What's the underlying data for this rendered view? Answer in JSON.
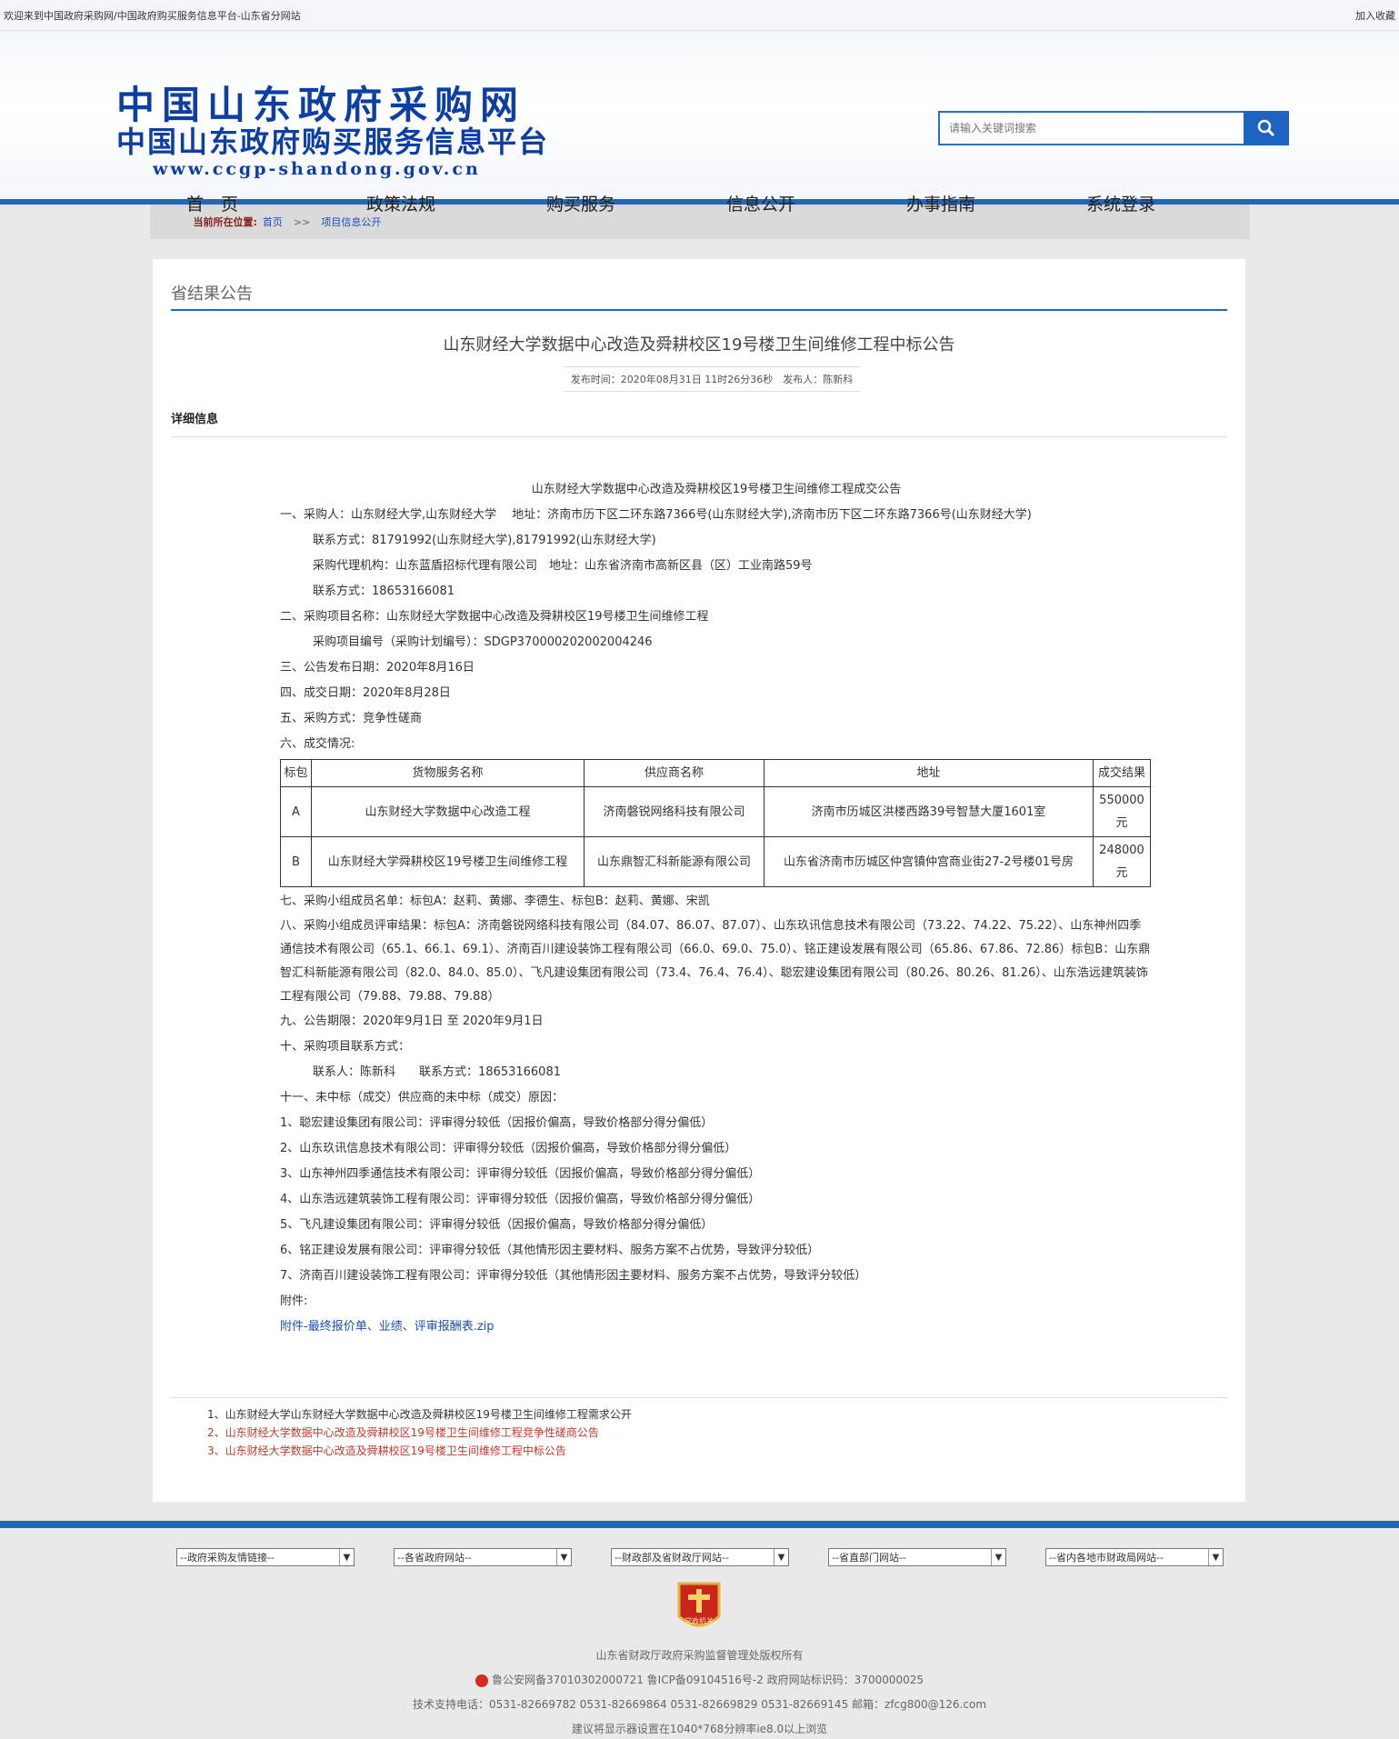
{
  "topbar": {
    "welcome": "欢迎来到中国政府采购网/中国政府购买服务信息平台-山东省分网站",
    "bookmark": "加入收藏"
  },
  "logo": {
    "line1": "中国山东政府采购网",
    "line2": "中国山东政府购买服务信息平台",
    "line3": "www.ccgp-shandong.gov.cn"
  },
  "search": {
    "placeholder": "请输入关键词搜索"
  },
  "nav": [
    "首　页",
    "政策法规",
    "购买服务",
    "信息公开",
    "办事指南",
    "系统登录"
  ],
  "breadcrumb": {
    "label": "当前所在位置:",
    "home": "首页",
    "sep": ">>",
    "current": "项目信息公开"
  },
  "section_title": "省结果公告",
  "article": {
    "title": "山东财经大学数据中心改造及舜耕校区19号楼卫生间维修工程中标公告",
    "meta": "发布时间：2020年08月31日 11时26分36秒　发布人：陈新科",
    "detail_heading": "详细信息",
    "body_title": "山东财经大学数据中心改造及舜耕校区19号楼卫生间维修工程成交公告",
    "lines1": [
      "一、采购人：山东财经大学,山东财经大学　 地址：济南市历下区二环东路7366号(山东财经大学),济南市历下区二环东路7366号(山东财经大学)"
    ],
    "lines1_ind": [
      "联系方式：81791992(山东财经大学),81791992(山东财经大学)",
      "采购代理机构：山东蓝盾招标代理有限公司　地址：山东省济南市高新区县（区）工业南路59号",
      "联系方式：18653166081"
    ],
    "line2": "二、采购项目名称：山东财经大学数据中心改造及舜耕校区19号楼卫生间维修工程",
    "line2_ind": "采购项目编号（采购计划编号）：SDGP370000202002004246",
    "line3": "三、公告发布日期：2020年8月16日",
    "line4": "四、成交日期：2020年8月28日",
    "line5": "五、采购方式：竞争性磋商",
    "line6": "六、成交情况:",
    "table": {
      "headers": [
        "标包",
        "货物服务名称",
        "供应商名称",
        "地址",
        "成交结果"
      ],
      "rows": [
        [
          "A",
          "山东财经大学数据中心改造工程",
          "济南磐锐网络科技有限公司",
          "济南市历城区洪楼西路39号智慧大厦1601室",
          "550000元"
        ],
        [
          "B",
          "山东财经大学舜耕校区19号楼卫生间维修工程",
          "山东鼎智汇科新能源有限公司",
          "山东省济南市历城区仲宫镇仲宫商业街27-2号楼01号房",
          "248000元"
        ]
      ]
    },
    "line7": "七、采购小组成员名单：标包A：赵莉、黄娜、李德生、标包B：赵莉、黄娜、宋凯",
    "line8": "八、采购小组成员评审结果：标包A：济南磐锐网络科技有限公司（84.07、86.07、87.07）、山东玖讯信息技术有限公司（73.22、74.22、75.22）、山东神州四季通信技术有限公司（65.1、66.1、69.1）、济南百川建设装饰工程有限公司（66.0、69.0、75.0）、铭正建设发展有限公司（65.86、67.86、72.86）标包B：山东鼎智汇科新能源有限公司（82.0、84.0、85.0）、飞凡建设集团有限公司（73.4、76.4、76.4）、聪宏建设集团有限公司（80.26、80.26、81.26）、山东浩远建筑装饰工程有限公司（79.88、79.88、79.88）",
    "line9": "九、公告期限：2020年9月1日 至 2020年9月1日",
    "line10": "十、采购项目联系方式：",
    "line10_ind": "联系人：陈新科　　联系方式：18653166081",
    "line11": "十一、未中标（成交）供应商的未中标（成交）原因：",
    "reasons": [
      "1、聪宏建设集团有限公司：评审得分较低（因报价偏高，导致价格部分得分偏低）",
      "2、山东玖讯信息技术有限公司：评审得分较低（因报价偏高，导致价格部分得分偏低）",
      "3、山东神州四季通信技术有限公司：评审得分较低（因报价偏高，导致价格部分得分偏低）",
      "4、山东浩远建筑装饰工程有限公司：评审得分较低（因报价偏高，导致价格部分得分偏低）",
      "5、飞凡建设集团有限公司：评审得分较低（因报价偏高，导致价格部分得分偏低）",
      "6、铭正建设发展有限公司：评审得分较低（其他情形因主要材料、服务方案不占优势，导致评分较低）",
      "7、济南百川建设装饰工程有限公司：评审得分较低（其他情形因主要材料、服务方案不占优势，导致评分较低）"
    ],
    "attachment_label": "附件:",
    "attachment_link": "附件-最终报价单、业绩、评审报酬表.zip"
  },
  "related": [
    "1、山东财经大学山东财经大学数据中心改造及舜耕校区19号楼卫生间维修工程需求公开",
    "2、山东财经大学数据中心改造及舜耕校区19号楼卫生间维修工程竞争性磋商公告",
    "3、山东财经大学数据中心改造及舜耕校区19号楼卫生间维修工程中标公告"
  ],
  "footer": {
    "selects": [
      "--政府采购友情链接--",
      "--各省政府网站--",
      "--财政部及省财政厅网站--",
      "--省直部门网站--",
      "--省内各地市财政局网站--"
    ],
    "badge_text": "党政机关",
    "copyright": "山东省财政厅政府采购监督管理处版权所有",
    "icp": "鲁公安网备37010302000721  鲁ICP备09104516号-2  政府网站标识码：3700000025",
    "support": "技术支持电话：0531-82669782 0531-82669864 0531-82669829 0531-82669145 邮箱：zfcg800@126.com",
    "resolution": "建议将显示器设置在1040*768分辨率ie8.0以上浏览"
  },
  "colors": {
    "brand_blue": "#2566b6",
    "logo_blue": "#0c3ea3",
    "related_red": "#c0392b"
  }
}
